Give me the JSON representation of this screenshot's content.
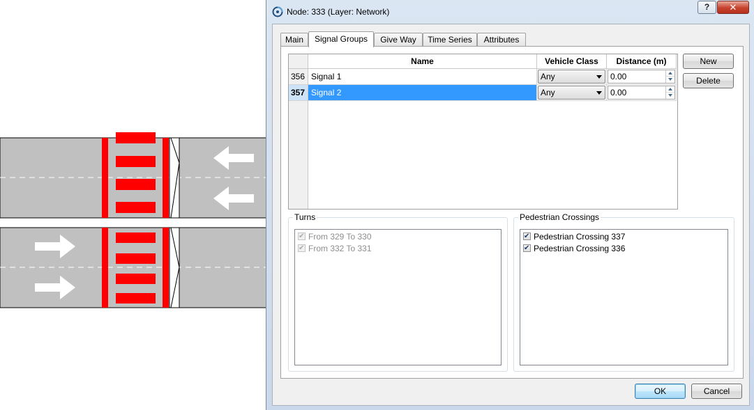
{
  "window": {
    "title": "Node: 333 (Layer: Network)",
    "help_label": "?",
    "close_label": "✕"
  },
  "tabs": [
    {
      "label": "Main",
      "active": false
    },
    {
      "label": "Signal Groups",
      "active": true
    },
    {
      "label": "Give Way",
      "active": false
    },
    {
      "label": "Time Series",
      "active": false
    },
    {
      "label": "Attributes",
      "active": false
    }
  ],
  "signal_grid": {
    "columns": [
      "Name",
      "Vehicle Class",
      "Distance (m)"
    ],
    "rows": [
      {
        "id": "356",
        "name": "Signal 1",
        "vehicle_class": "Any",
        "distance": "0.00",
        "selected": false
      },
      {
        "id": "357",
        "name": "Signal 2",
        "vehicle_class": "Any",
        "distance": "0.00",
        "selected": true
      }
    ]
  },
  "buttons": {
    "new": "New",
    "delete": "Delete",
    "ok": "OK",
    "cancel": "Cancel"
  },
  "turns": {
    "label": "Turns",
    "items": [
      {
        "label": "From 329 To 330",
        "checked": true,
        "enabled": false
      },
      {
        "label": "From 332 To 331",
        "checked": true,
        "enabled": false
      }
    ]
  },
  "pedestrian_crossings": {
    "label": "Pedestrian Crossings",
    "items": [
      {
        "label": "Pedestrian Crossing 337",
        "checked": true,
        "enabled": true
      },
      {
        "label": "Pedestrian Crossing 336",
        "checked": true,
        "enabled": true
      }
    ]
  },
  "colors": {
    "road": "#c0c0c0",
    "crossing": "#ff0000",
    "arrow": "#ffffff",
    "selection": "#3399ff"
  }
}
